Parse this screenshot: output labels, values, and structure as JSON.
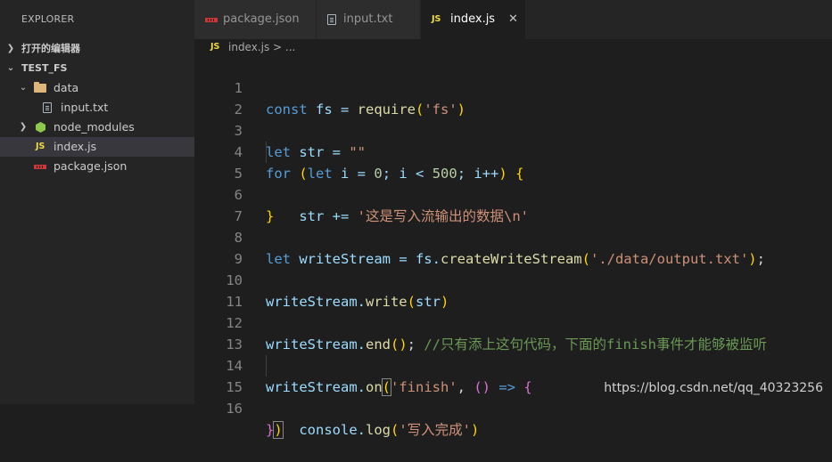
{
  "sidebar": {
    "title": "EXPLORER",
    "open_editors": "打开的编辑器",
    "project": "TEST_FS",
    "tree": {
      "data_folder": "data",
      "input_file": "input.txt",
      "node_modules": "node_modules",
      "index_file": "index.js",
      "package_file": "package.json"
    }
  },
  "tabs": [
    {
      "label": "package.json",
      "icon": "npm-icon"
    },
    {
      "label": "input.txt",
      "icon": "text-file-icon"
    },
    {
      "label": "index.js",
      "icon": "js-icon",
      "active": true
    }
  ],
  "tab_close": "✕",
  "breadcrumb": {
    "file": "index.js",
    "separator": " > ",
    "ellipsis": "..."
  },
  "js_badge": "JS",
  "line_numbers": [
    "1",
    "2",
    "3",
    "4",
    "5",
    "6",
    "7",
    "8",
    "9",
    "10",
    "11",
    "12",
    "13",
    "14",
    "15",
    "16"
  ],
  "code": {
    "l1": {
      "kw": "const",
      "a": " fs = ",
      "fn": "require",
      "p1": "(",
      "str": "'fs'",
      "p2": ")"
    },
    "l3": {
      "kw": "let",
      "a": " str = ",
      "str": "\"\""
    },
    "l4": {
      "kw1": "for",
      "a": " ",
      "p1": "(",
      "kw2": "let",
      "b": " i = ",
      "n1": "0",
      "c": "; i < ",
      "n2": "500",
      "d": "; i++",
      "p2": ")",
      "e": " ",
      "p3": "{"
    },
    "l5": {
      "a": "    str += ",
      "str": "'这是写入流输出的数据\\n'"
    },
    "l6": {
      "p": "}"
    },
    "l8": {
      "kw": "let",
      "a": " writeStream = fs.",
      "fn": "createWriteStream",
      "p1": "(",
      "str": "'./data/output.txt'",
      "p2": ")",
      "b": ";"
    },
    "l10": {
      "a": "writeStream.",
      "fn": "write",
      "p1": "(",
      "b": "str",
      "p2": ")"
    },
    "l12": {
      "a": "writeStream.",
      "fn": "end",
      "p": "()",
      "b": "; ",
      "cm": "//只有添上这句代码，下面的finish事件才能够被监听"
    },
    "l14": {
      "a": "writeStream.",
      "fn": "on",
      "p1": "(",
      "str": "'finish'",
      "b": ", ",
      "p2": "()",
      "c": " => ",
      "p3": "{"
    },
    "l15": {
      "a": "    console.",
      "fn": "log",
      "p1": "(",
      "str": "'写入完成'",
      "p2": ")"
    },
    "l16": {
      "p1": "}",
      "p2": ")"
    }
  },
  "watermark": "https://blog.csdn.net/qq_40323256",
  "colors": {
    "keyword": "#569cd6",
    "string": "#ce9178",
    "number": "#b5cea8",
    "function": "#dcdcaa",
    "comment": "#6a9955",
    "bracket_level1": "#ffd700",
    "bracket_level2": "#da70d6"
  }
}
